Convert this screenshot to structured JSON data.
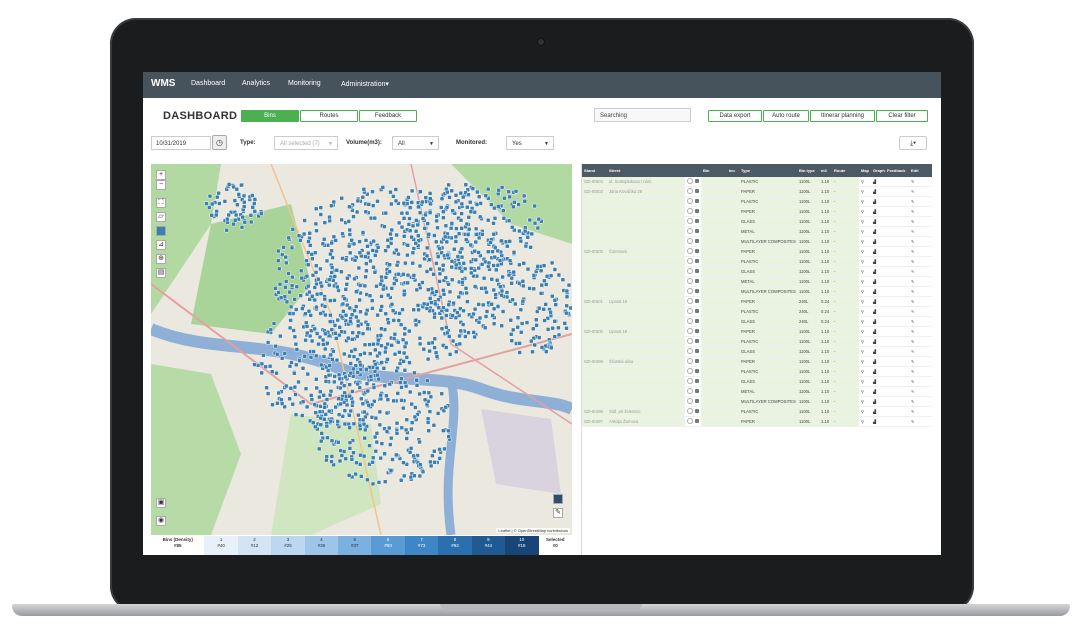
{
  "nav": {
    "brand": "WMS",
    "items": [
      "Dashboard",
      "Analytics",
      "Monitoring",
      "Administration"
    ]
  },
  "toolbar": {
    "title": "DASHBOARD",
    "tabs": [
      "Bins",
      "Routes",
      "Feedback"
    ],
    "search_placeholder": "Searching",
    "actions": [
      "Data export",
      "Auto route",
      "Itinerar planning",
      "Clear filter"
    ]
  },
  "filters": {
    "date": "10/31/2019",
    "type_label": "Type:",
    "type_value": "All selected (7)",
    "volume_label": "Volume(m3):",
    "volume_value": "All",
    "monitored_label": "Monitored:",
    "monitored_value": "Yes",
    "download_icon": "download-icon"
  },
  "map": {
    "attribution": "Leaflet | © OpenStreetMap contributors",
    "controls": [
      "+",
      "−"
    ],
    "colors": {
      "land": "#e9e7e0",
      "forest": "#a9d59d",
      "water": "#8fa9c9",
      "pin": "#3c7fb1"
    }
  },
  "legend": {
    "label": "Bins (Density)",
    "selected_label": "Selected",
    "selected_value": "#0",
    "buckets": [
      {
        "num": "1",
        "count": "#40",
        "sub": "≤9"
      },
      {
        "num": "2",
        "count": "#12",
        "sub": "≤6"
      },
      {
        "num": "3",
        "count": "#25",
        "sub": "≤5"
      },
      {
        "num": "4",
        "count": "#36",
        "sub": "≤5"
      },
      {
        "num": "5",
        "count": "#37",
        "sub": "≤7"
      },
      {
        "num": "6",
        "count": "#50",
        "sub": "≤8"
      },
      {
        "num": "7",
        "count": "#73",
        "sub": "≤8"
      },
      {
        "num": "8",
        "count": "#83",
        "sub": "≤9"
      },
      {
        "num": "9",
        "count": "#44",
        "sub": "≤9"
      },
      {
        "num": "10",
        "count": "#15",
        "sub": "≤9"
      }
    ],
    "head_sub": "#85",
    "colors": [
      "#e8f1fa",
      "#d3e5f5",
      "#bcd7ef",
      "#9cc5e7",
      "#7bb1de",
      "#5a9bd3",
      "#3e86c5",
      "#2b6fae",
      "#1f5a93",
      "#174577"
    ]
  },
  "table": {
    "columns": [
      "Stand",
      "Street",
      "",
      "",
      "Bin",
      "km",
      "Type",
      "Bin type",
      "m3",
      "Route",
      "Map",
      "Graph",
      "Feedback",
      "Edit"
    ],
    "rows": [
      {
        "stand": "SZI-IE504",
        "street": "ul. Svätoplukova / nám.",
        "bin": "",
        "type": "PLASTIC",
        "bintype": "1100L",
        "m3": "1.10"
      },
      {
        "stand": "SZI-IE503",
        "street": "Jána Kováčika 28",
        "bin": "",
        "type": "PAPER",
        "bintype": "1100L",
        "m3": "1.10"
      },
      {
        "stand": "",
        "street": "",
        "bin": "",
        "type": "PLASTIC",
        "bintype": "1100L",
        "m3": "1.10"
      },
      {
        "stand": "",
        "street": "",
        "bin": "",
        "type": "PAPER",
        "bintype": "1100L",
        "m3": "1.10"
      },
      {
        "stand": "",
        "street": "",
        "bin": "",
        "type": "GLASS",
        "bintype": "1100L",
        "m3": "1.10"
      },
      {
        "stand": "",
        "street": "",
        "bin": "",
        "type": "METAL",
        "bintype": "1100L",
        "m3": "1.10"
      },
      {
        "stand": "",
        "street": "",
        "bin": "",
        "type": "MULTILAYER COMPOSITES",
        "bintype": "1100L",
        "m3": "1.10"
      },
      {
        "stand": "SZI-IE502",
        "street": "Čulenová",
        "bin": "",
        "type": "PAPER",
        "bintype": "1100L",
        "m3": "1.10"
      },
      {
        "stand": "",
        "street": "",
        "bin": "",
        "type": "PLASTIC",
        "bintype": "1100L",
        "m3": "1.10"
      },
      {
        "stand": "",
        "street": "",
        "bin": "",
        "type": "GLASS",
        "bintype": "1100L",
        "m3": "1.10"
      },
      {
        "stand": "",
        "street": "",
        "bin": "",
        "type": "METAL",
        "bintype": "1100L",
        "m3": "1.10"
      },
      {
        "stand": "",
        "street": "",
        "bin": "",
        "type": "MULTILAYER COMPOSITES",
        "bintype": "1100L",
        "m3": "1.10"
      },
      {
        "stand": "SZI-IE501",
        "street": "Lipová 19",
        "bin": "",
        "type": "PAPER",
        "bintype": "240L",
        "m3": "0.24"
      },
      {
        "stand": "",
        "street": "",
        "bin": "",
        "type": "PLASTIC",
        "bintype": "240L",
        "m3": "0.24"
      },
      {
        "stand": "",
        "street": "",
        "bin": "",
        "type": "GLASS",
        "bintype": "240L",
        "m3": "0.24"
      },
      {
        "stand": "SZI-IE500",
        "street": "Lipová 19",
        "bin": "",
        "type": "PAPER",
        "bintype": "1100L",
        "m3": "1.10"
      },
      {
        "stand": "",
        "street": "",
        "bin": "",
        "type": "PLASTIC",
        "bintype": "1100L",
        "m3": "1.10"
      },
      {
        "stand": "",
        "street": "",
        "bin": "",
        "type": "GLASS",
        "bintype": "1100L",
        "m3": "1.10"
      },
      {
        "stand": "SZI-IE499",
        "street": "Šťastná ulica",
        "bin": "",
        "type": "PAPER",
        "bintype": "1100L",
        "m3": "1.10"
      },
      {
        "stand": "",
        "street": "",
        "bin": "",
        "type": "PLASTIC",
        "bintype": "1100L",
        "m3": "1.10"
      },
      {
        "stand": "",
        "street": "",
        "bin": "",
        "type": "GLASS",
        "bintype": "1100L",
        "m3": "1.10"
      },
      {
        "stand": "",
        "street": "",
        "bin": "",
        "type": "METAL",
        "bintype": "1100L",
        "m3": "1.10"
      },
      {
        "stand": "",
        "street": "",
        "bin": "",
        "type": "MULTILAYER COMPOSITES",
        "bintype": "1100L",
        "m3": "1.10"
      },
      {
        "stand": "SZI-IE498",
        "street": "Sídl. pri železnici",
        "bin": "",
        "type": "PLASTIC",
        "bintype": "1100L",
        "m3": "1.10"
      },
      {
        "stand": "SZI-IE497",
        "street": "Antolja Žarnova",
        "bin": "",
        "type": "PAPER",
        "bintype": "1100L",
        "m3": "1.10"
      }
    ]
  }
}
